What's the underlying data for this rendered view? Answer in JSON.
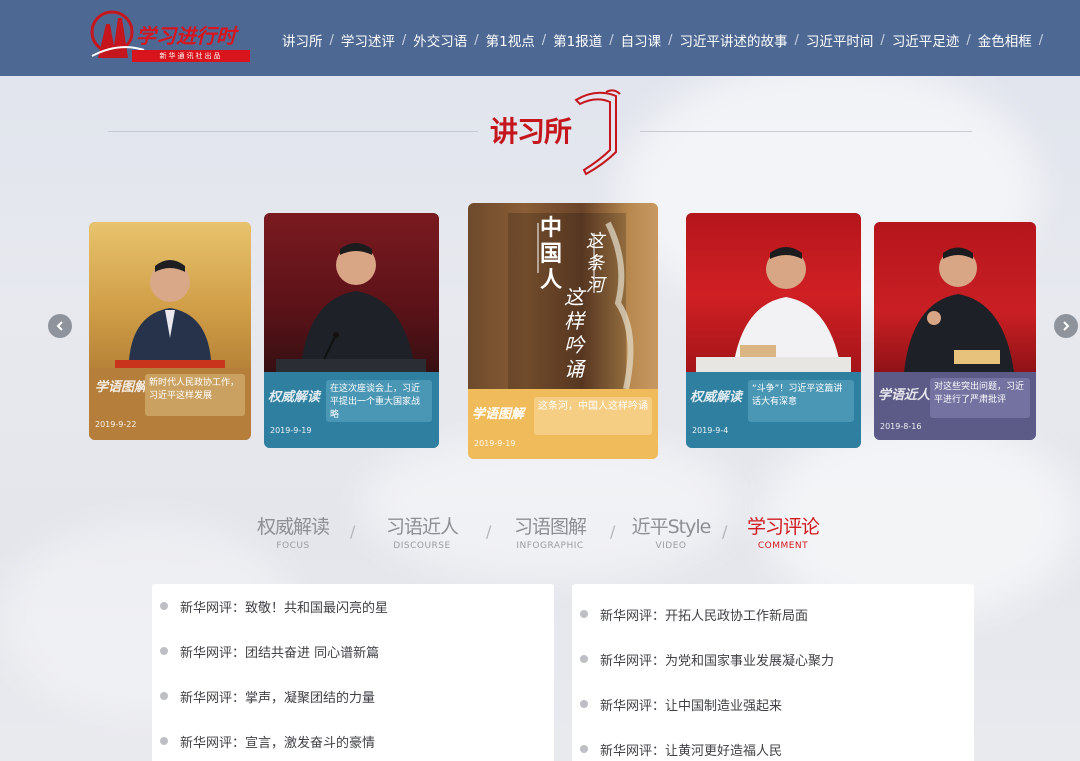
{
  "header": {
    "logo_text": "学习进行时",
    "logo_sub": "新华通讯社出品",
    "nav": [
      "讲习所",
      "学习述评",
      "外交习语",
      "第1视点",
      "第1报道",
      "自习课",
      "习近平讲述的故事",
      "习近平时间",
      "习近平足迹",
      "金色相框"
    ],
    "separator": "/"
  },
  "section": {
    "title": "讲习所"
  },
  "carousel": {
    "cards": [
      {
        "tag": "学语图解",
        "date": "2019-9-22",
        "caption": "新时代人民政协工作，习近平这样发展",
        "theme": "#b07b3a"
      },
      {
        "tag": "权威解读",
        "date": "2019-9-19",
        "caption": "在这次座谈会上，习近平提出一个重大国家战略",
        "theme": "#2f7fa0"
      },
      {
        "tag": "学语图解",
        "date": "2019-9-19",
        "caption": "这条河，中国人这样吟诵",
        "theme": "#e8a93f"
      },
      {
        "tag": "权威解读",
        "date": "2019-9-4",
        "caption": "“斗争”！习近平这篇讲话大有深意",
        "theme": "#2f7fa0"
      },
      {
        "tag": "学语近人",
        "date": "2019-8-16",
        "caption": "对这些突出问题，习近平进行了严肃批评",
        "theme": "#5c5a86"
      }
    ],
    "poster_lines": [
      "中国人",
      "这条河",
      "这样吟诵"
    ]
  },
  "tabs": [
    {
      "zh": "权威解读",
      "en": "FOCUS",
      "active": false
    },
    {
      "zh": "习语近人",
      "en": "DISCOURSE",
      "active": false
    },
    {
      "zh": "习语图解",
      "en": "INFOGRAPHIC",
      "active": false
    },
    {
      "zh": "近平Style",
      "en": "VIDEO",
      "active": false
    },
    {
      "zh": "学习评论",
      "en": "COMMENT",
      "active": true
    }
  ],
  "lists": {
    "left": [
      "新华网评：致敬！共和国最闪亮的星",
      "新华网评：团结共奋进 同心谱新篇",
      "新华网评：掌声，凝聚团结的力量",
      "新华网评：宣言，激发奋斗的豪情"
    ],
    "right": [
      "新华网评：开拓人民政协工作新局面",
      "新华网评：为党和国家事业发展凝心聚力",
      "新华网评：让中国制造业强起来",
      "新华网评：让黄河更好造福人民"
    ]
  },
  "colors": {
    "header_bg": "#4d6893",
    "accent_red": "#d0191f"
  }
}
